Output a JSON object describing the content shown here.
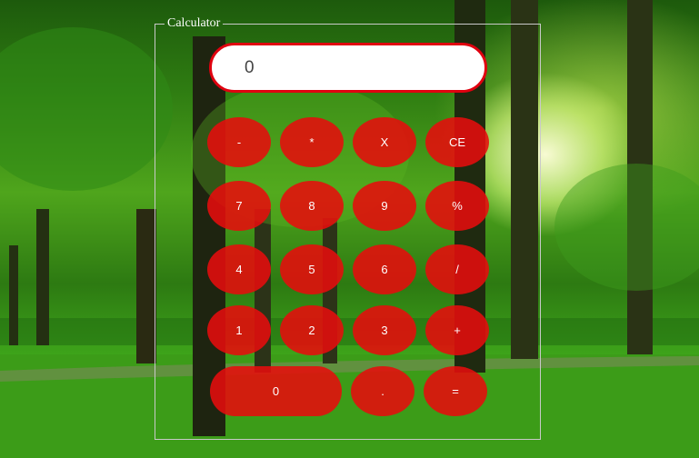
{
  "calculator": {
    "legend": "Calculator",
    "display_value": "0",
    "keys": {
      "minus": "-",
      "multiply": "*",
      "x": "X",
      "clear_entry": "CE",
      "seven": "7",
      "eight": "8",
      "nine": "9",
      "percent": "%",
      "four": "4",
      "five": "5",
      "six": "6",
      "divide": "/",
      "one": "1",
      "two": "2",
      "three": "3",
      "plus": "+",
      "zero": "0",
      "decimal": ".",
      "equals": "="
    }
  },
  "colors": {
    "key_fill": "#e60c0c",
    "display_border": "#e0000f",
    "fieldset_border": "#c9c9c9"
  }
}
